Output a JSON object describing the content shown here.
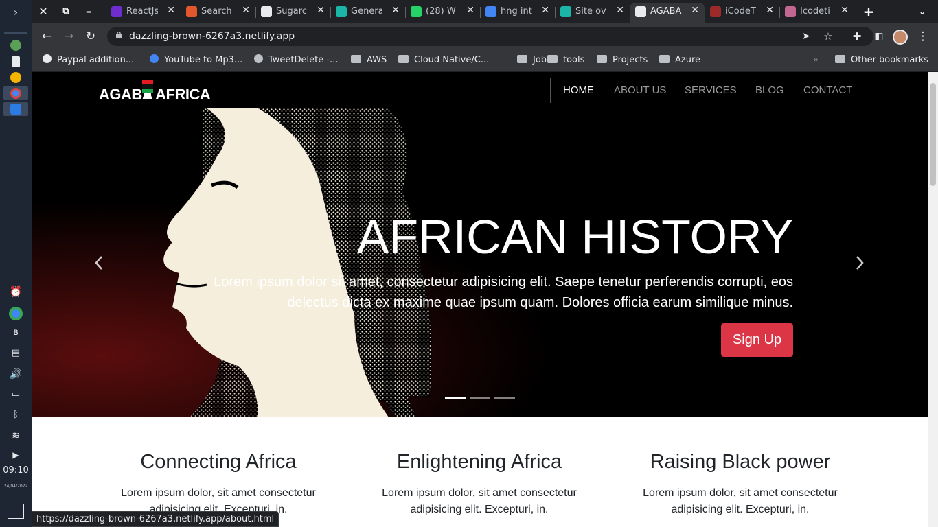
{
  "shelf": {
    "time": "09:10",
    "date": "24/04/2022"
  },
  "tabs": [
    {
      "title": "ReactJs",
      "icon": "reactjs-favicon",
      "color": "#6e2ecf"
    },
    {
      "title": "Search",
      "icon": "search-favicon",
      "color": "#e2572c"
    },
    {
      "title": "Sugarc",
      "icon": "github-favicon",
      "color": "#e8eaed"
    },
    {
      "title": "Genera",
      "icon": "netlify-favicon",
      "color": "#1bb6a6"
    },
    {
      "title": "(28) W",
      "icon": "whatsapp-favicon",
      "color": "#25d366"
    },
    {
      "title": "hng int",
      "icon": "google-favicon",
      "color": "#4285f4"
    },
    {
      "title": "Site ov",
      "icon": "netlify-favicon",
      "color": "#1bb6a6"
    },
    {
      "title": "AGABA",
      "icon": "globe-favicon",
      "color": "#e8eaed",
      "active": true
    },
    {
      "title": "iCodeT",
      "icon": "spider-favicon",
      "color": "#9c2a2a"
    },
    {
      "title": "Icodeti",
      "icon": "user-favicon",
      "color": "#c2678f"
    }
  ],
  "toolbar": {
    "url": "dazzling-brown-6267a3.netlify.app"
  },
  "bookmarks": [
    {
      "label": "Paypal addition...",
      "icon": "paypal-icon"
    },
    {
      "label": "YouTube to Mp3...",
      "icon": "info-icon"
    },
    {
      "label": "TweetDelete -...",
      "icon": "trash-icon"
    },
    {
      "label": "AWS",
      "icon": "folder-icon"
    },
    {
      "label": "Cloud Native/C...",
      "icon": "folder-icon"
    },
    {
      "label": "Jobs",
      "icon": "folder-icon"
    },
    {
      "label": "tools",
      "icon": "folder-icon"
    },
    {
      "label": "Projects",
      "icon": "folder-icon"
    },
    {
      "label": "Azure",
      "icon": "folder-icon"
    }
  ],
  "other_bookmarks": "Other bookmarks",
  "site": {
    "logo": "AGABA AFRICA",
    "nav": [
      {
        "label": "HOME",
        "active": true
      },
      {
        "label": "ABOUT US",
        "active": false
      },
      {
        "label": "SERVICES",
        "active": false
      },
      {
        "label": "BLOG",
        "active": false
      },
      {
        "label": "CONTACT",
        "active": false
      }
    ],
    "hero": {
      "title": "AFRICAN HISTORY",
      "text": "Lorem ipsum dolor sit amet, consectetur adipisicing elit. Saepe tenetur perferendis corrupti, eos delectus dicta ex maxime quae ipsum quam. Dolores officia earum similique minus.",
      "button": "Sign Up",
      "slide_count": 3,
      "active_slide": 1
    },
    "features": [
      {
        "title": "Connecting Africa",
        "text": "Lorem ipsum dolor, sit amet consectetur adipisicing elit. Excepturi, in."
      },
      {
        "title": "Enlightening Africa",
        "text": "Lorem ipsum dolor, sit amet consectetur adipisicing elit. Excepturi, in."
      },
      {
        "title": "Raising Black power",
        "text": "Lorem ipsum dolor, sit amet consectetur adipisicing elit. Excepturi, in."
      }
    ]
  },
  "status_url": "https://dazzling-brown-6267a3.netlify.app/about.html",
  "colors": {
    "accent": "#dc3545",
    "hero_bg": "#000000",
    "chrome_bg": "#35363a"
  }
}
